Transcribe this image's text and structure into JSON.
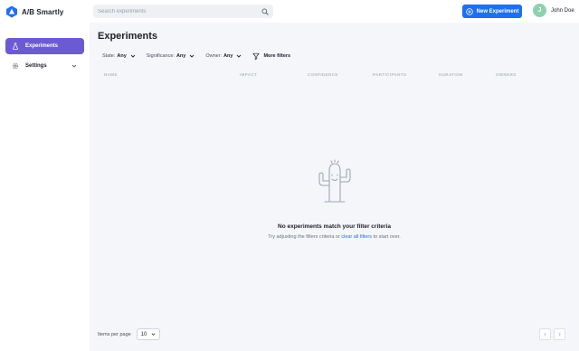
{
  "app": {
    "name": "A/B Smartly"
  },
  "header": {
    "search_placeholder": "Search experiments",
    "new_button_label": "New Experiment",
    "user": {
      "initial": "J",
      "name": "John Doe"
    }
  },
  "sidebar": {
    "items": [
      {
        "label": "Experiments",
        "icon": "flask-icon",
        "active": true
      },
      {
        "label": "Settings",
        "icon": "gear-icon",
        "active": false
      }
    ]
  },
  "main": {
    "title": "Experiments",
    "filters": {
      "state": {
        "label": "State:",
        "value": "Any"
      },
      "significance": {
        "label": "Significance:",
        "value": "Any"
      },
      "owner": {
        "label": "Owner:",
        "value": "Any"
      },
      "more_label": "More filters"
    },
    "columns": [
      "NAME",
      "IMPACT",
      "CONFIDENCE",
      "PARTICIPANTS",
      "DURATION",
      "OWNERS"
    ],
    "empty_state": {
      "title": "No experiments match your filter criteria",
      "subtitle_before": "Try adjusting the filters criteria or ",
      "subtitle_link": "clear all filters",
      "subtitle_after": " to start over."
    },
    "pagination": {
      "per_page_label": "Items per page",
      "per_page_value": "10"
    }
  },
  "colors": {
    "primary": "#1e6ff1",
    "sidebar_active": "#6c5ad3",
    "avatar": "#8fd0b0"
  }
}
